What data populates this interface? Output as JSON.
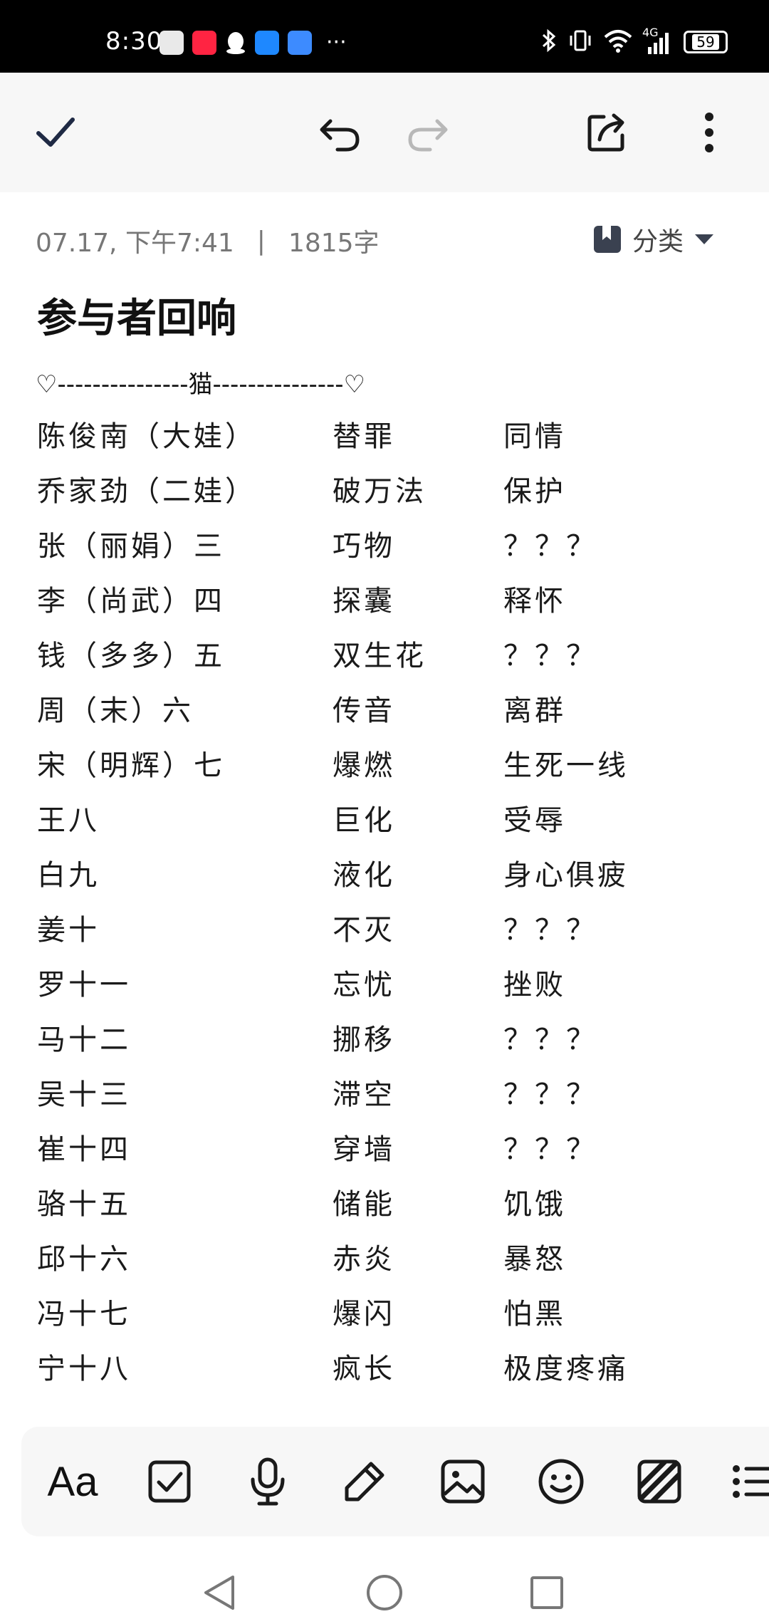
{
  "status_bar": {
    "time": "8:30",
    "battery": "59",
    "network": "4G",
    "more": "···"
  },
  "toolbar": {
    "done_icon": "check-icon",
    "undo_icon": "undo-icon",
    "redo_icon": "redo-icon",
    "share_icon": "share-icon",
    "more_icon": "more-vertical-icon"
  },
  "note": {
    "timestamp": "07.17, 下午7:41",
    "separator": "|",
    "word_count": "1815字",
    "category_label": "分类",
    "title": "参与者回响",
    "divider": "♡---------------猫---------------♡"
  },
  "roster": [
    [
      "陈俊南（大娃）",
      "替罪",
      "同情"
    ],
    [
      "乔家劲（二娃）",
      "破万法",
      "保护"
    ],
    [
      "张（丽娟）三",
      "巧物",
      "？？？"
    ],
    [
      "李（尚武）四",
      "探囊",
      "释怀"
    ],
    [
      "钱（多多）五",
      "双生花",
      "？？？"
    ],
    [
      "周（末）六",
      "传音",
      "离群"
    ],
    [
      "宋（明辉）七",
      "爆燃",
      "生死一线"
    ],
    [
      "王八",
      "巨化",
      "受辱"
    ],
    [
      "白九",
      "液化",
      "身心俱疲"
    ],
    [
      "姜十",
      "不灭",
      "？？？"
    ],
    [
      "罗十一",
      "忘忧",
      "挫败"
    ],
    [
      "马十二",
      "挪移",
      "？？？"
    ],
    [
      "吴十三",
      "滞空",
      "？？？"
    ],
    [
      "崔十四",
      "穿墙",
      "？？？"
    ],
    [
      "骆十五",
      "储能",
      "饥饿"
    ],
    [
      "邱十六",
      "赤炎",
      "暴怒"
    ],
    [
      "冯十七",
      "爆闪",
      "怕黑"
    ],
    [
      "宁十八",
      "疯长",
      "极度疼痛"
    ]
  ],
  "format_bar": {
    "text_style_label": "Aa"
  }
}
